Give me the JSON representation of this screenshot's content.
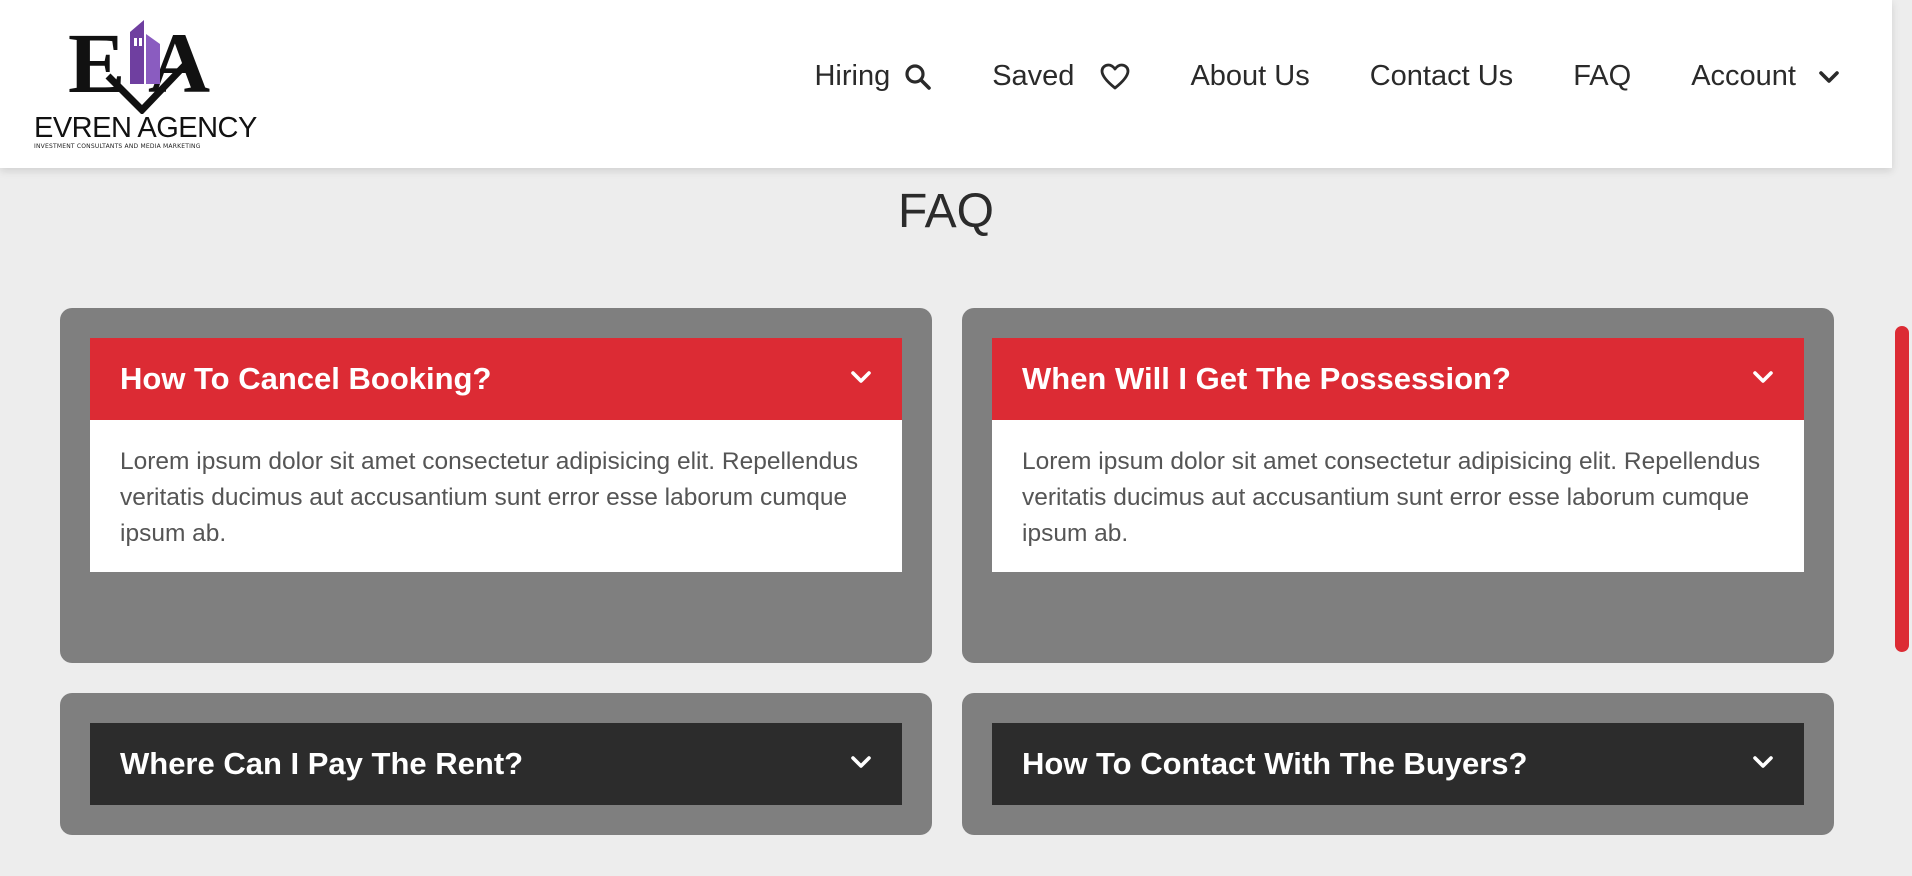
{
  "brand": {
    "name": "EVREN AGENCY",
    "tagline": "INVESTMENT CONSULTANTS AND MEDIA MARKETING",
    "logo_letters": "EA",
    "accent_purple": "#6f3fa0"
  },
  "nav": {
    "items": [
      {
        "label": "Hiring",
        "icon": "search-icon"
      },
      {
        "label": "Saved",
        "icon": "heart-icon"
      },
      {
        "label": "About Us"
      },
      {
        "label": "Contact Us"
      },
      {
        "label": "FAQ"
      },
      {
        "label": "Account",
        "icon": "chevron-down-icon"
      }
    ]
  },
  "page": {
    "title": "FAQ"
  },
  "faq": [
    {
      "question": "How To Cancel Booking?",
      "expanded": true,
      "answer": "Lorem ipsum dolor sit amet consectetur adipisicing elit. Repellendus veritatis ducimus aut accusantium sunt error esse laborum cumque ipsum ab."
    },
    {
      "question": "When Will I Get The Possession?",
      "expanded": true,
      "answer": "Lorem ipsum dolor sit amet consectetur adipisicing elit. Repellendus veritatis ducimus aut accusantium sunt error esse laborum cumque ipsum ab."
    },
    {
      "question": "Where Can I Pay The Rent?",
      "expanded": false
    },
    {
      "question": "How To Contact With The Buyers?",
      "expanded": false
    }
  ],
  "colors": {
    "accent_red": "#dc2b34",
    "card_gray": "#7f7f7f",
    "collapsed_header": "#2c2c2c",
    "page_bg": "#ededed"
  }
}
